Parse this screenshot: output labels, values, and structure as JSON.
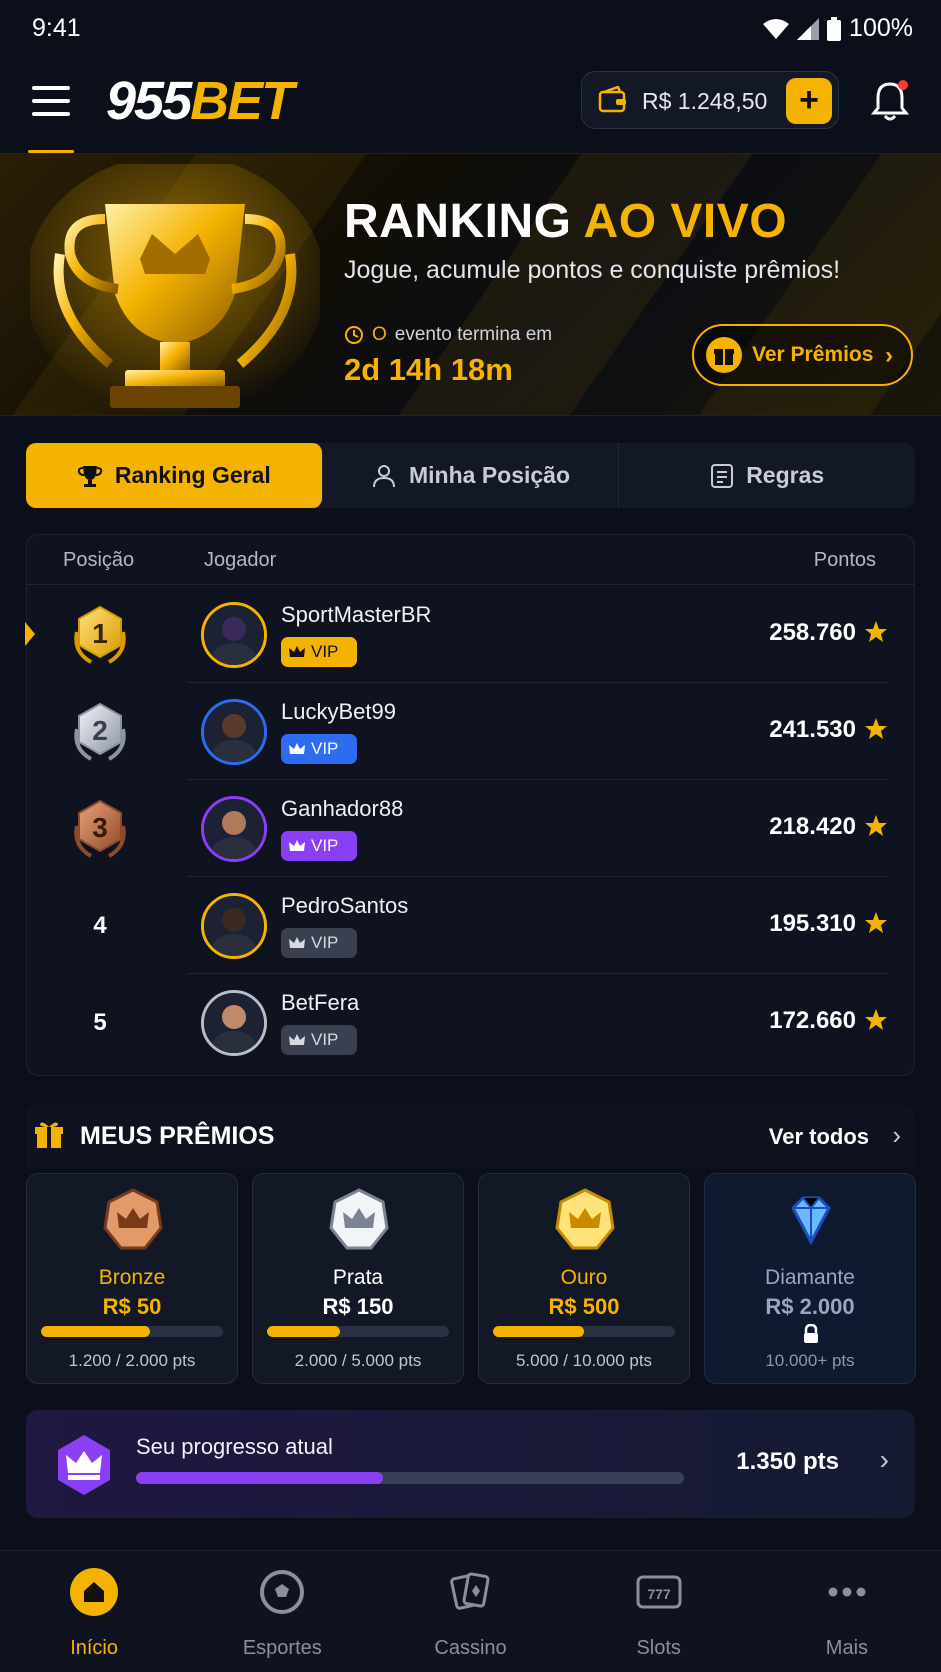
{
  "status": {
    "time": "9:41",
    "battery": "100%"
  },
  "header": {
    "logo_white": "955",
    "logo_yellow": "BET",
    "balance": "R$ 1.248,50"
  },
  "hero": {
    "title_white": "RANKING ",
    "title_yellow": "AO VIVO",
    "subtitle": "Jogue, acumule pontos e conquiste prêmios!",
    "ends_zero": "O",
    "ends_text": "evento termina em",
    "timer": "2d 14h 18m",
    "button": "Ver Prêmios"
  },
  "tabs": [
    {
      "label": "Ranking Geral",
      "active": true
    },
    {
      "label": "Minha Posição",
      "active": false
    },
    {
      "label": "Regras",
      "active": false
    }
  ],
  "ranking": {
    "headers": {
      "position": "Posição",
      "player": "Jogador",
      "points": "Pontos"
    },
    "rows": [
      {
        "pos": "1",
        "name": "SportMasterBR",
        "vip": "VIP",
        "points": "258.760",
        "tier": "gold"
      },
      {
        "pos": "2",
        "name": "LuckyBet99",
        "vip": "VIP",
        "points": "241.530",
        "tier": "silver"
      },
      {
        "pos": "3",
        "name": "Ganhador88",
        "vip": "VIP",
        "points": "218.420",
        "tier": "bronze"
      },
      {
        "pos": "4",
        "name": "PedroSantos",
        "vip": "VIP",
        "points": "195.310",
        "tier": "none"
      },
      {
        "pos": "5",
        "name": "BetFera",
        "vip": "VIP",
        "points": "172.660",
        "tier": "none"
      }
    ]
  },
  "prizes": {
    "title": "MEUS PRÊMIOS",
    "see_all": "Ver todos",
    "cards": [
      {
        "name": "Bronze",
        "value": "R$ 50",
        "pts": "1.200 / 2.000 pts",
        "progress": 0.6,
        "color": "#f5b301",
        "locked": false
      },
      {
        "name": "Prata",
        "value": "R$ 150",
        "pts": "2.000 / 5.000 pts",
        "progress": 0.4,
        "color": "#ffffff",
        "locked": false
      },
      {
        "name": "Ouro",
        "value": "R$ 500",
        "pts": "5.000 / 10.000 pts",
        "progress": 0.5,
        "color": "#f5b301",
        "locked": false
      },
      {
        "name": "Diamante",
        "value": "R$ 2.000",
        "pts": "10.000+ pts",
        "progress": 0,
        "color": "#9aa6bf",
        "locked": true
      }
    ]
  },
  "progress": {
    "label": "Seu progresso atual",
    "points": "1.350 pts",
    "fraction": 0.45
  },
  "nav": [
    {
      "label": "Início",
      "icon": "home-icon",
      "active": true
    },
    {
      "label": "Esportes",
      "icon": "ball-icon",
      "active": false
    },
    {
      "label": "Cassino",
      "icon": "cards-icon",
      "active": false
    },
    {
      "label": "Slots",
      "icon": "slot-machine-icon",
      "active": false
    },
    {
      "label": "Mais",
      "icon": "more-icon",
      "active": false
    }
  ],
  "colors": {
    "accent": "#f5b301",
    "background": "#0b0f19",
    "card": "#131826",
    "purple": "#8a3ff5",
    "vip_blue": "#2d6cf0",
    "vip_purple": "#8a3ff5"
  }
}
